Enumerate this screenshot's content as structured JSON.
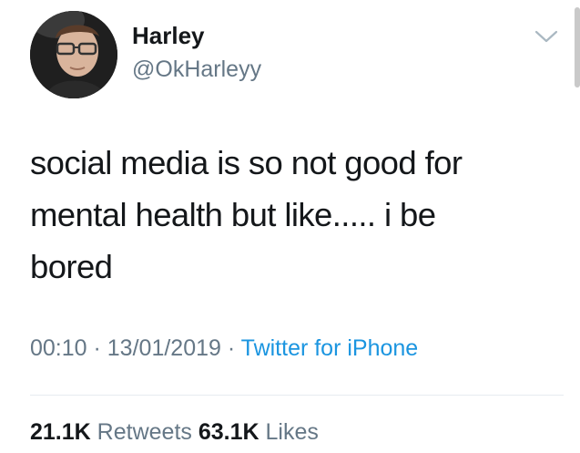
{
  "user": {
    "display_name": "Harley",
    "handle": "@OkHarleyy"
  },
  "tweet": {
    "text_lines": [
      "social media is so not good for",
      "mental health but like..... i be",
      "bored"
    ],
    "time": "00:10",
    "date": "13/01/2019",
    "separator": " · ",
    "source": "Twitter for iPhone"
  },
  "stats": {
    "retweets_count": "21.1K",
    "retweets_label": "Retweets",
    "likes_count": "63.1K",
    "likes_label": "Likes"
  },
  "icons": {
    "menu": "chevron-down-icon",
    "avatar": "avatar"
  },
  "colors": {
    "text": "#14171a",
    "secondary": "#657786",
    "link": "#1b95e0",
    "divider": "#e6ecf0"
  }
}
